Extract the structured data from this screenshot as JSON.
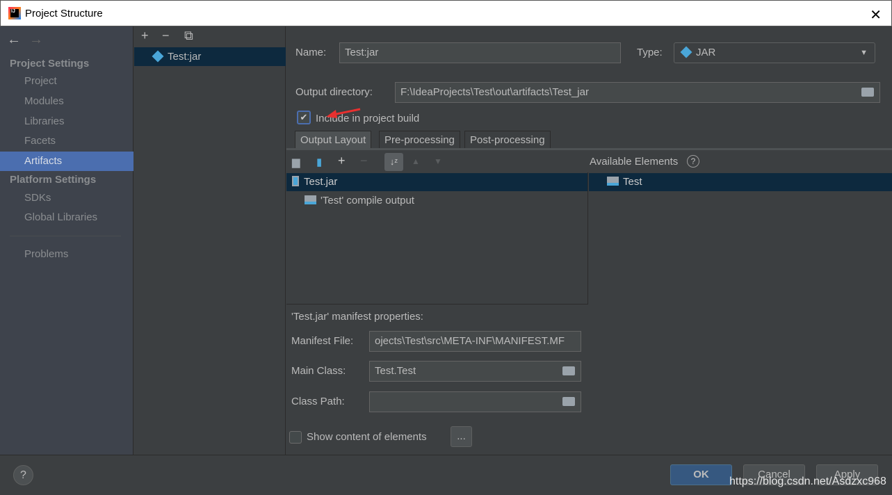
{
  "window": {
    "title": "Project Structure",
    "close": "✕"
  },
  "sidebar": {
    "back": "←",
    "forward": "→",
    "sections": [
      {
        "label": "Project Settings",
        "items": [
          "Project",
          "Modules",
          "Libraries",
          "Facets",
          "Artifacts"
        ]
      },
      {
        "label": "Platform Settings",
        "items": [
          "SDKs",
          "Global Libraries"
        ]
      }
    ],
    "problems": "Problems",
    "selected": "Artifacts"
  },
  "artifacts": {
    "add": "+",
    "remove": "−",
    "copy": "⧉",
    "items": [
      "Test:jar"
    ]
  },
  "form": {
    "name_label": "Name:",
    "name_value": "Test:jar",
    "type_label": "Type:",
    "type_value": "JAR",
    "output_label": "Output directory:",
    "output_value": "F:\\IdeaProjects\\Test\\out\\artifacts\\Test_jar",
    "include_label": "Include in project build",
    "include_checked": true
  },
  "tabs": [
    "Output Layout",
    "Pre-processing",
    "Post-processing"
  ],
  "layout": {
    "tree": [
      "Test.jar",
      "'Test' compile output"
    ],
    "available_label": "Available Elements",
    "available": [
      "Test"
    ]
  },
  "manifest": {
    "title": "'Test.jar' manifest properties:",
    "file_label": "Manifest File:",
    "file_value": "ojects\\Test\\src\\META-INF\\MANIFEST.MF",
    "main_label": "Main Class:",
    "main_value": "Test.Test",
    "classpath_label": "Class Path:",
    "classpath_value": ""
  },
  "show_content": {
    "label": "Show content of elements",
    "checked": false,
    "more": "..."
  },
  "footer": {
    "help": "?",
    "ok": "OK",
    "cancel": "Cancel",
    "apply": "Apply",
    "watermark": "https://blog.csdn.net/Asdzxc968"
  },
  "colors": {
    "accent": "#4b6eaf",
    "selection": "#0d293e",
    "annotation_arrow": "#e8302f"
  }
}
